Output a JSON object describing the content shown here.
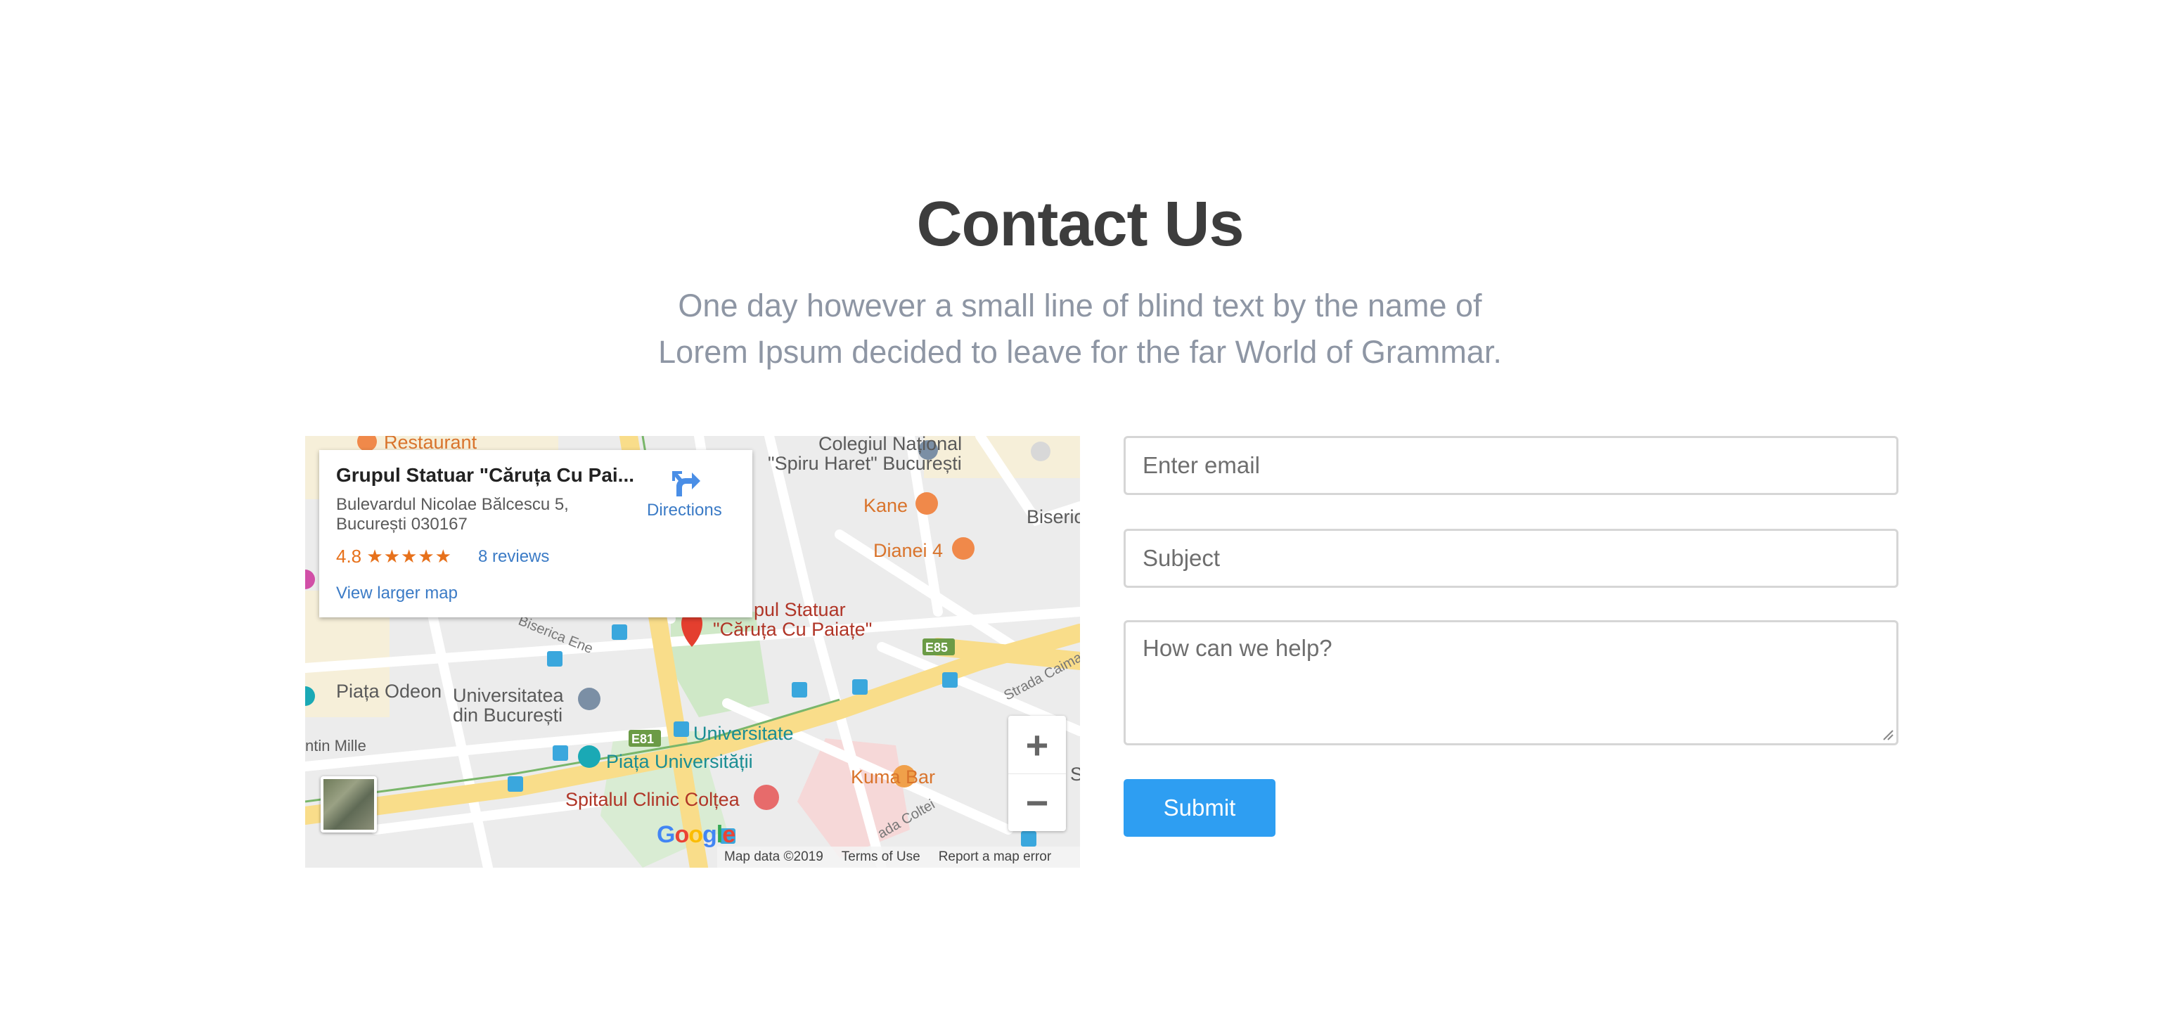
{
  "header": {
    "title": "Contact Us",
    "subtitle": "One day however a small line of blind text by the name of Lorem Ipsum decided to leave for the far World of Grammar."
  },
  "map": {
    "place_name": "Grupul Statuar \"Căruța Cu Pai...",
    "address": "Bulevardul Nicolae Bălcescu 5, București 030167",
    "rating": "4.8",
    "stars": "★★★★★",
    "reviews": "8 reviews",
    "directions": "Directions",
    "view_larger": "View larger map",
    "labels": {
      "restaurant": "Restaurant",
      "colegiul": "Colegiul Național",
      "spiru": "\"Spiru Haret\" București",
      "kane": "Kane",
      "biseric": "Biseric",
      "dianei": "Dianei 4",
      "grupul_1": "pul Statuar",
      "grupul_2": "\"Căruța Cu Paiațe\"",
      "biserica_ene": "Biserica Ene",
      "e85": "E85",
      "strada_caimat": "Strada Caimat",
      "piata_odeon": "Piața Odeon",
      "universitatea_1": "Universitatea",
      "universitatea_2": "din București",
      "e81": "E81",
      "universitate": "Universitate",
      "ntin_mille": "ntin Mille",
      "piata_universitatii": "Piața Universității",
      "kuma_bar": "Kuma Bar",
      "spitalul": "Spitalul Clinic Colțea",
      "strada_coltei": "ada Coltei",
      "s_edge": "S"
    },
    "zoom_in": "+",
    "zoom_out": "−",
    "footer": {
      "map_data": "Map data ©2019",
      "terms": "Terms of Use",
      "report": "Report a map error"
    }
  },
  "form": {
    "email_placeholder": "Enter email",
    "subject_placeholder": "Subject",
    "message_placeholder": "How can we help?",
    "submit_label": "Submit"
  },
  "colors": {
    "accent": "#2e9ef2",
    "title": "#3d3d3d",
    "subtitle": "#8e96a4"
  }
}
